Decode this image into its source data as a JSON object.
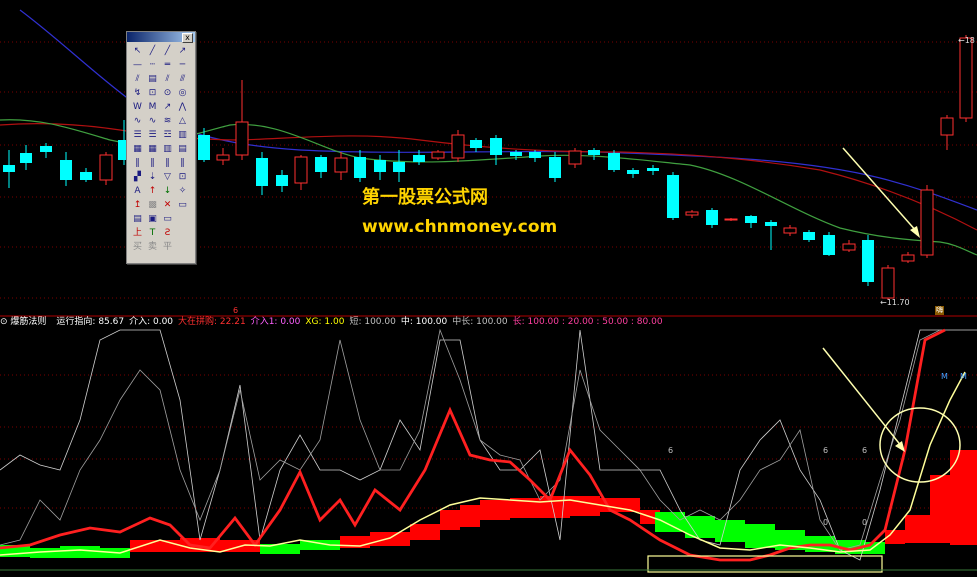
{
  "watermark": {
    "title": "第一股票公式网",
    "url": "www.chnmoney.com"
  },
  "price_panel": {
    "high_label": "18",
    "low_label": "11.70",
    "top_marker": "6",
    "right_marker": "嗨"
  },
  "indicator": {
    "name": "爆筋法则",
    "items": [
      {
        "label": "运行指向: 85.67",
        "color": "#ffffff"
      },
      {
        "label": "介入: 0.00",
        "color": "#ffffff"
      },
      {
        "label": "大在拼购: 22.21",
        "color": "#ff3030"
      },
      {
        "label": "介入1: 0.00",
        "color": "#ff60ff"
      },
      {
        "label": "XG: 1.00",
        "color": "#ffff00"
      },
      {
        "label": "短: 100.00",
        "color": "#c0c0c0"
      },
      {
        "label": "中: 100.00",
        "color": "#ffffff"
      },
      {
        "label": "中长: 100.00",
        "color": "#c0c0c0"
      },
      {
        "label": "长: 100.00 : 20.00 : 50.00 : 80.00",
        "color": "#ff40a0"
      }
    ],
    "signals": [
      "M",
      "M"
    ],
    "value_marks": [
      "6",
      "6",
      "6",
      "0",
      "0"
    ]
  },
  "toolbox": {
    "close": "x",
    "tools": [
      {
        "name": "cursor-icon",
        "g": "↖"
      },
      {
        "name": "line-icon",
        "g": "╱"
      },
      {
        "name": "ray-icon",
        "g": "╱"
      },
      {
        "name": "arrow-line-icon",
        "g": "↗"
      },
      {
        "name": "horizontal-line-icon",
        "g": "—"
      },
      {
        "name": "dashed-line-icon",
        "g": "┄"
      },
      {
        "name": "segment-icon",
        "g": "═"
      },
      {
        "name": "extend-line-icon",
        "g": "─"
      },
      {
        "name": "parallel-icon",
        "g": "⫽"
      },
      {
        "name": "channel-icon",
        "g": "▤"
      },
      {
        "name": "fan-line-icon",
        "g": "⫽"
      },
      {
        "name": "grid-line-icon",
        "g": "⫻"
      },
      {
        "name": "cycle-icon",
        "g": "↯"
      },
      {
        "name": "square-icon",
        "g": "⊡"
      },
      {
        "name": "circle-icon",
        "g": "⊙"
      },
      {
        "name": "spiral-icon",
        "g": "◎"
      },
      {
        "name": "wave-icon",
        "g": "W"
      },
      {
        "name": "wave-m-icon",
        "g": "M"
      },
      {
        "name": "zigzag-icon",
        "g": "↗"
      },
      {
        "name": "peak-icon",
        "g": "⋀"
      },
      {
        "name": "curve-icon",
        "g": "∿"
      },
      {
        "name": "curve2-icon",
        "g": "∿"
      },
      {
        "name": "curve3-icon",
        "g": "≋"
      },
      {
        "name": "triangle-up-icon",
        "g": "△"
      },
      {
        "name": "fib-icon",
        "g": "☰"
      },
      {
        "name": "fib2-icon",
        "g": "☰"
      },
      {
        "name": "fib3-icon",
        "g": "☲"
      },
      {
        "name": "fib4-icon",
        "g": "▥"
      },
      {
        "name": "bars-icon",
        "g": "▦"
      },
      {
        "name": "bars2-icon",
        "g": "▦"
      },
      {
        "name": "bars3-icon",
        "g": "▥"
      },
      {
        "name": "bars4-icon",
        "g": "▤"
      },
      {
        "name": "vertical-lines-icon",
        "g": "‖"
      },
      {
        "name": "vertical2-icon",
        "g": "‖"
      },
      {
        "name": "vertical3-icon",
        "g": "‖"
      },
      {
        "name": "vertical4-icon",
        "g": "‖"
      },
      {
        "name": "gann-icon",
        "g": "▞"
      },
      {
        "name": "down-arrow-icon",
        "g": "⇣"
      },
      {
        "name": "triangle-icon",
        "g": "▽"
      },
      {
        "name": "frame-icon",
        "g": "⊡"
      },
      {
        "name": "text-icon",
        "g": "A"
      },
      {
        "name": "up-arrow-red-icon",
        "g": "↑",
        "c": "red"
      },
      {
        "name": "down-arrow-green-icon",
        "g": "↓",
        "c": "green"
      },
      {
        "name": "star-icon",
        "g": "✧"
      },
      {
        "name": "flag-up-icon",
        "g": "↥",
        "c": "red"
      },
      {
        "name": "gray-box-icon",
        "g": "▩",
        "c": "gray"
      },
      {
        "name": "delete-icon",
        "g": "✕",
        "c": "red"
      },
      {
        "name": "rect-icon",
        "g": "▭"
      },
      {
        "name": "note-icon",
        "g": "▤"
      },
      {
        "name": "box-icon",
        "g": "▣"
      },
      {
        "name": "panel-icon",
        "g": "▭"
      },
      {
        "name": "blank-icon",
        "g": ""
      },
      {
        "name": "buy-mark-icon",
        "g": "上",
        "c": "red"
      },
      {
        "name": "sell-mark-icon",
        "g": "T",
        "c": "green"
      },
      {
        "name": "hold-mark-icon",
        "g": "Ƨ",
        "c": "red"
      },
      {
        "name": "blank2-icon",
        "g": ""
      },
      {
        "name": "buy-text-icon",
        "g": "买",
        "c": "gray"
      },
      {
        "name": "sell-text-icon",
        "g": "卖",
        "c": "gray"
      },
      {
        "name": "flat-text-icon",
        "g": "平",
        "c": "gray"
      },
      {
        "name": "blank3-icon",
        "g": ""
      }
    ]
  },
  "colors": {
    "up": "#ff3030",
    "down": "#00ffff",
    "ma_blue": "#3030d0",
    "ma_red": "#b01010",
    "ma_green": "#40a040",
    "block_red": "#ff0000",
    "block_green": "#00ff00",
    "line_red": "#ff2020",
    "line_yellow": "#ffff99",
    "line_white": "#d0d0d0",
    "arrow": "#ffffb0"
  }
}
